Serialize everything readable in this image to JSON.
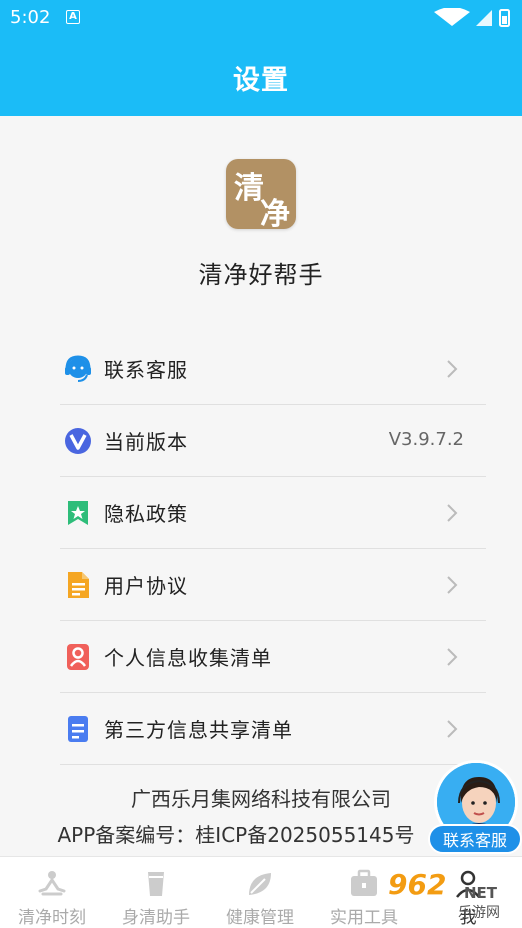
{
  "status_bar": {
    "time": "5:02",
    "notification_icon": "A"
  },
  "header": {
    "title": "设置"
  },
  "app": {
    "name": "清净好帮手",
    "logo_chars": [
      "清",
      "净"
    ]
  },
  "menu": [
    {
      "label": "联系客服",
      "icon": "headset-icon",
      "trailing": "chevron"
    },
    {
      "label": "当前版本",
      "icon": "version-icon",
      "trailing": "V3.9.7.2"
    },
    {
      "label": "隐私政策",
      "icon": "bookmark-star-icon",
      "trailing": "chevron"
    },
    {
      "label": "用户协议",
      "icon": "document-icon",
      "trailing": "chevron"
    },
    {
      "label": "个人信息收集清单",
      "icon": "person-card-icon",
      "trailing": "chevron"
    },
    {
      "label": "第三方信息共享清单",
      "icon": "list-document-icon",
      "trailing": "chevron"
    }
  ],
  "version_value": "V3.9.7.2",
  "footer": {
    "company": "广西乐月集网络科技有限公司",
    "icp": "APP备案编号：桂ICP备2025055145号"
  },
  "floating_cs": {
    "label": "联系客服"
  },
  "tabs": [
    {
      "label": "清净时刻",
      "icon": "meditation-icon"
    },
    {
      "label": "身清助手",
      "icon": "cup-icon"
    },
    {
      "label": "健康管理",
      "icon": "leaf-icon"
    },
    {
      "label": "实用工具",
      "icon": "toolbox-icon"
    },
    {
      "label": "我",
      "icon": "user-icon"
    }
  ],
  "watermark": {
    "brand": "962",
    "net": "NET",
    "sub": "乐游网"
  },
  "colors": {
    "primary": "#1bbcf7",
    "logo": "#b29164",
    "background": "#f6f6f6"
  }
}
